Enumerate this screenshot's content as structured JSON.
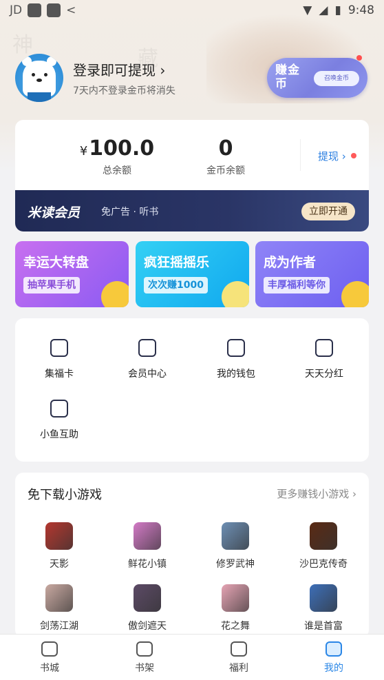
{
  "status_bar": {
    "carrier": "JD",
    "time": "9:48"
  },
  "profile": {
    "login_title": "登录即可提现",
    "login_subtitle": "7天内不登录金币将消失",
    "earn_badge_main": "赚金币",
    "earn_badge_pill": "召唤金币"
  },
  "balance": {
    "currency_symbol": "¥",
    "total_value": "100.0",
    "total_label": "总余额",
    "coin_value": "0",
    "coin_label": "金币余额",
    "withdraw_label": "提现"
  },
  "vip": {
    "logo": "米读会员",
    "desc": "免广告 · 听书",
    "button": "立即开通"
  },
  "promos": [
    {
      "title": "幸运大转盘",
      "subtitle": "抽苹果手机",
      "color_from": "#c86ff0",
      "color_to": "#8a5bf2",
      "text_color": "#8a4fd9"
    },
    {
      "title": "疯狂摇摇乐",
      "subtitle": "次次赚1000",
      "color_from": "#34d0f4",
      "color_to": "#10a8ef",
      "text_color": "#1592d8"
    },
    {
      "title": "成为作者",
      "subtitle": "丰厚福利等你",
      "color_from": "#8f84f7",
      "color_to": "#6d5ff0",
      "text_color": "#6b5be6"
    }
  ],
  "features": [
    {
      "label": "集福卡",
      "icon": "card-icon"
    },
    {
      "label": "会员中心",
      "icon": "member-icon"
    },
    {
      "label": "我的钱包",
      "icon": "wallet-icon"
    },
    {
      "label": "天天分红",
      "icon": "money-bag-icon"
    },
    {
      "label": "小鱼互助",
      "icon": "gift-plus-icon"
    }
  ],
  "games_section": {
    "title": "免下载小游戏",
    "more": "更多赚钱小游戏 ›"
  },
  "games": [
    {
      "name": "天影",
      "color": "#b4372f"
    },
    {
      "name": "鲜花小镇",
      "color": "#d37ac6"
    },
    {
      "name": "修罗武神",
      "color": "#6d8fb4"
    },
    {
      "name": "沙巴克传奇",
      "color": "#5a2a14"
    },
    {
      "name": "剑荡江湖",
      "color": "#c9a9a1"
    },
    {
      "name": "傲剑遮天",
      "color": "#5c4a66"
    },
    {
      "name": "花之舞",
      "color": "#e6a4b4"
    },
    {
      "name": "谁是首富",
      "color": "#3d6fb8"
    }
  ],
  "bottom_nav": [
    {
      "label": "书城",
      "icon": "house-icon"
    },
    {
      "label": "书架",
      "icon": "book-icon"
    },
    {
      "label": "福利",
      "icon": "gift-icon"
    },
    {
      "label": "我的",
      "icon": "profile-icon",
      "active": true
    }
  ],
  "colors": {
    "accent": "#2a86e6",
    "badge_dot": "#ff4f4f",
    "vip_bg": "#202a55"
  }
}
